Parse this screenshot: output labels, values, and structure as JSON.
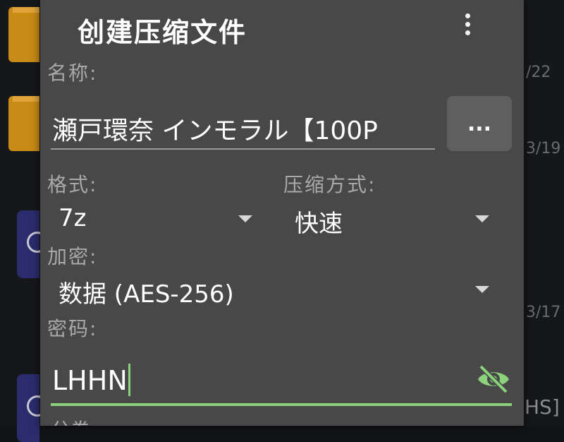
{
  "background": {
    "dates": [
      "/22",
      "3/19",
      "3/17"
    ],
    "tag": "HS]"
  },
  "dialog": {
    "title": "创建压缩文件",
    "more_icon": "more-vert-icon",
    "name": {
      "label": "名称:",
      "value": "瀬戸環奈 インモラル【100P",
      "browse_label": "..."
    },
    "format": {
      "label": "格式:",
      "value": "7z"
    },
    "compression": {
      "label": "压缩方式:",
      "value": "快速"
    },
    "encryption": {
      "label": "加密:",
      "value": "数据 (AES-256)"
    },
    "password": {
      "label": "密码:",
      "value": "LHHN",
      "visibility_icon": "eye-off-icon"
    },
    "next_label": "分卷"
  },
  "colors": {
    "dialog_bg": "#484848",
    "accent_green": "#8bd27c",
    "folder": "#c98a16"
  }
}
